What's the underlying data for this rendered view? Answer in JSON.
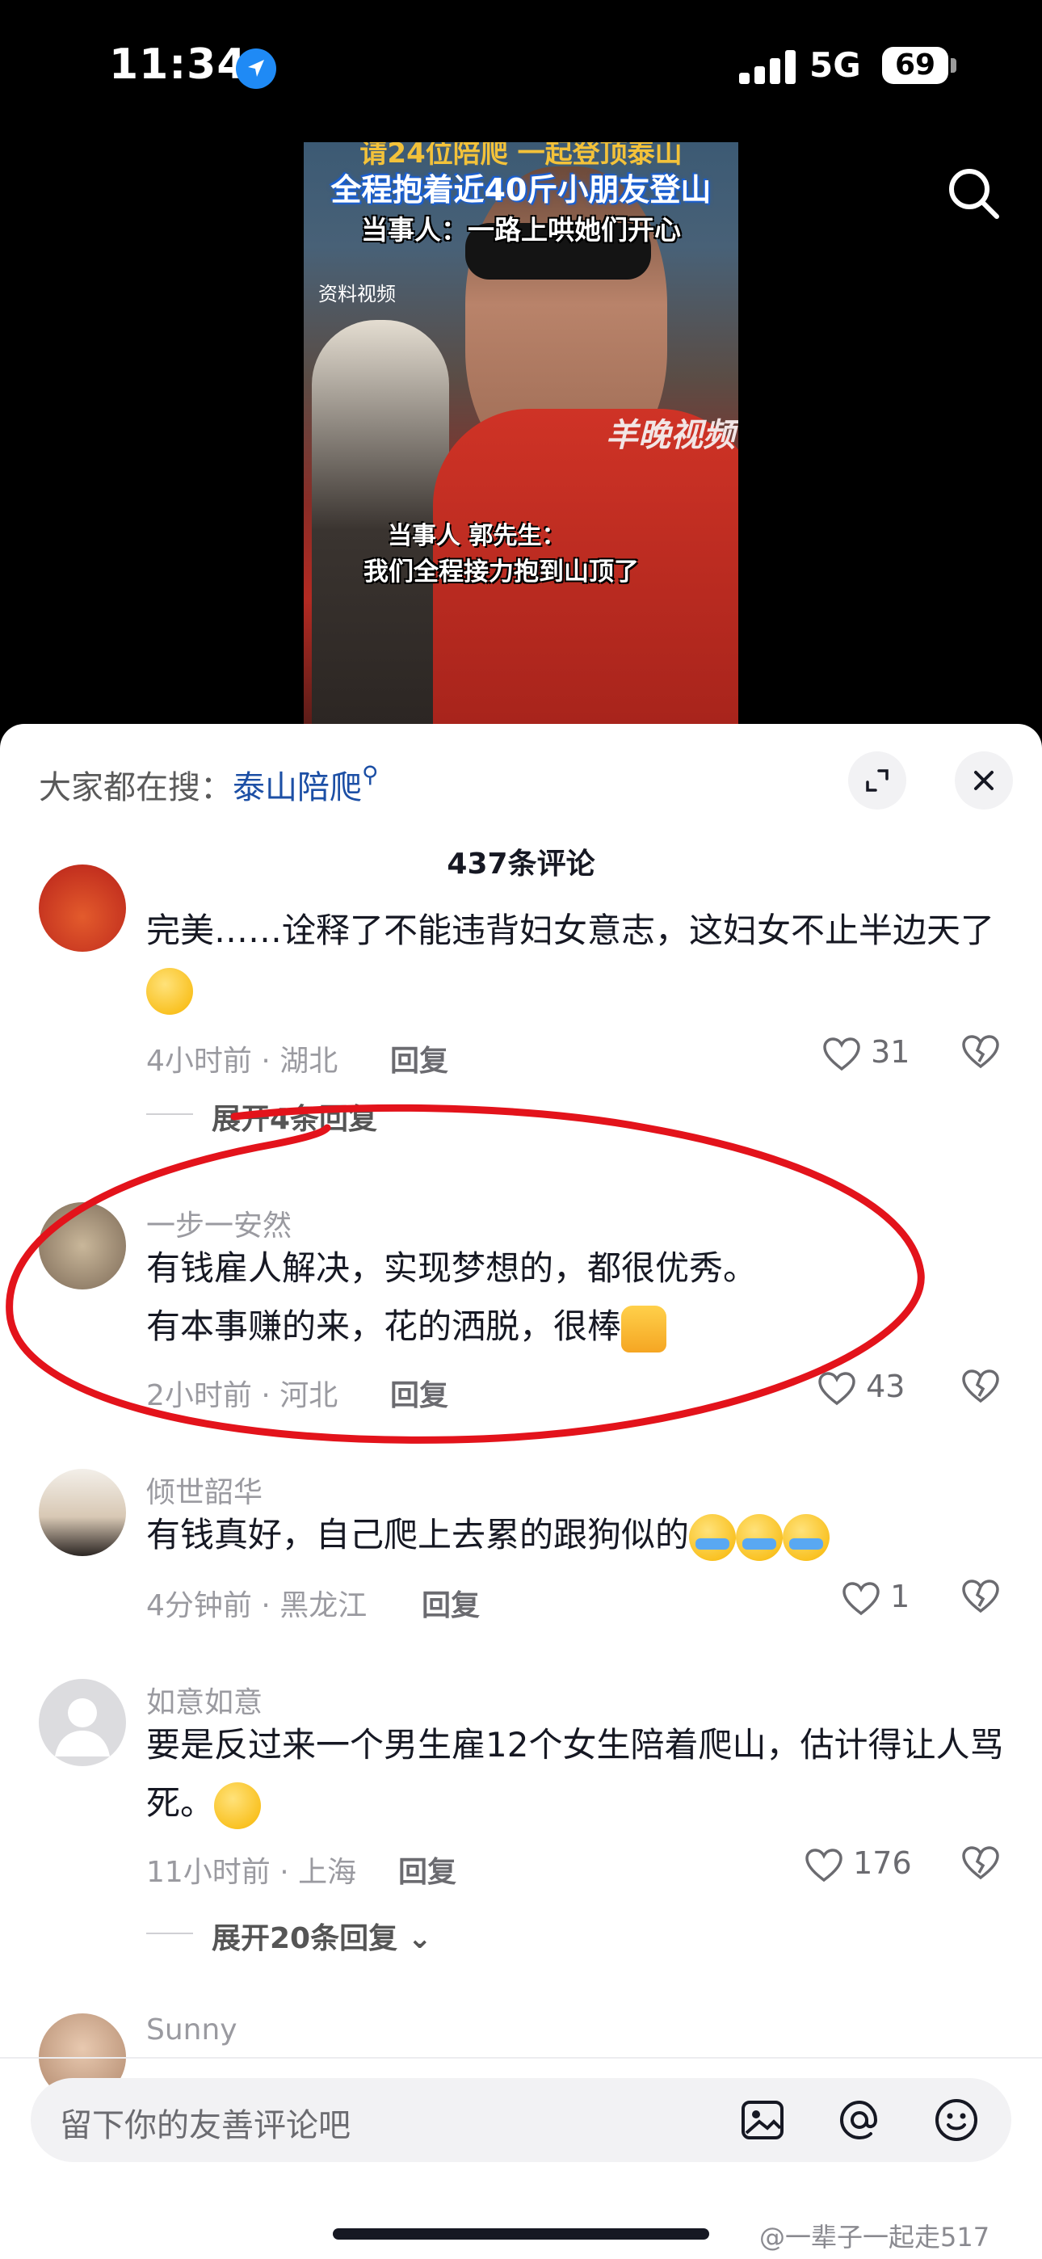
{
  "status_bar": {
    "time": "11:34",
    "network": "5G",
    "battery": "69"
  },
  "video": {
    "caption_top": "请24位陪爬 一起登顶泰山",
    "caption_line1": "全程抱着近40斤小朋友登山",
    "caption_line2": "当事人：一路上哄她们开心",
    "tag": "资料视频",
    "watermark": "羊晚视频",
    "speaker": "当事人 郭先生：",
    "subtitle": "我们全程接力抱到山顶了"
  },
  "sheet": {
    "hot_search_prefix": "大家都在搜：",
    "hot_search_keyword": "泰山陪爬",
    "comment_count": "437条评论"
  },
  "comments": [
    {
      "text": "完美……诠释了不能违背妇女意志，这妇女不止半边天了",
      "time": "4小时前 · 湖北",
      "reply": "回复",
      "likes": "31",
      "more": "展开4条回复"
    },
    {
      "username": "一步一安然",
      "line1": "有钱雇人解决，实现梦想的，都很优秀。",
      "line2": "有本事赚的来，花的洒脱，很棒",
      "time": "2小时前 · 河北",
      "reply": "回复",
      "likes": "43"
    },
    {
      "username": "倾世韶华",
      "text": "有钱真好，自己爬上去累的跟狗似的",
      "time": "4分钟前 · 黑龙江",
      "reply": "回复",
      "likes": "1"
    },
    {
      "username": "如意如意",
      "text": "要是反过来一个男生雇12个女生陪着爬山，估计得让人骂死。",
      "time": "11小时前 · 上海",
      "reply": "回复",
      "likes": "176",
      "more": "展开20条回复"
    },
    {
      "username": "Sunny"
    }
  ],
  "input": {
    "placeholder": "留下你的友善评论吧"
  },
  "footer_watermark": "@一辈子一起走517",
  "colors": {
    "annotation": "#e3131b",
    "keyword": "#1c4fa5"
  },
  "icons": [
    "location-arrow-icon",
    "search-icon",
    "expand-icon",
    "close-icon",
    "heart-icon",
    "broken-heart-icon",
    "image-icon",
    "at-icon",
    "emoji-icon"
  ]
}
